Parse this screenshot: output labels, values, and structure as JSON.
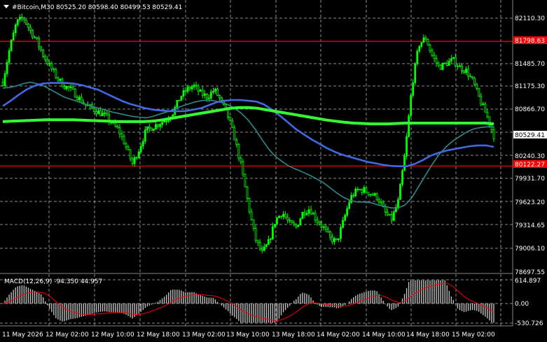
{
  "header": {
    "symbol_title": "#Bitcoin,M30",
    "ohlc": "80525.20 80598.40 80499.53 80529.41",
    "collapse_icon": "triangle-down-icon"
  },
  "colors": {
    "background": "#000000",
    "grid": "#ffffff",
    "bull_candle": "#00ff00",
    "ma_fast": "#2e8b8b",
    "ma_mid": "#4169e1",
    "ma_slow": "#33ff33",
    "hline": "#ff0000",
    "hline_label_bg": "#ff0000",
    "macd_hist": "#c0c0c0",
    "macd_signal": "#ff0000"
  },
  "price_axis": {
    "ticks": [
      "82110.30",
      "81485.70",
      "81175.30",
      "80866.70",
      "80240.30",
      "79931.70",
      "79623.20",
      "79314.65",
      "79006.10",
      "78697.55"
    ]
  },
  "price_tags": {
    "current": "80529.41",
    "level_top": "81798.63",
    "level_bottom": "80122.27"
  },
  "macd": {
    "label": "MACD(12,26,9) -94.350 44.957",
    "ticks": [
      "614.897",
      "0.00",
      "-530.726"
    ]
  },
  "time_axis": {
    "labels": [
      "11 May 2026",
      "12 May 02:00",
      "12 May 10:00",
      "12 May 18:00",
      "13 May 02:00",
      "13 May 10:00",
      "13 May 18:00",
      "14 May 02:00",
      "14 May 10:00",
      "14 May 18:00",
      "15 May 02:00"
    ]
  },
  "chart_data": {
    "type": "candlestick",
    "symbol": "#Bitcoin",
    "timeframe": "M30",
    "y_range": [
      78697.55,
      82110.3
    ],
    "horizontal_levels": [
      81798.63,
      80122.27
    ],
    "last_close": 80529.41,
    "series": [
      {
        "values": [
          81250,
          81700,
          82050,
          82120,
          81950,
          81800,
          81600,
          81450,
          81300,
          81200,
          81150,
          81050,
          80950,
          80900,
          80850,
          80800,
          80700,
          80600,
          80400,
          80150,
          80350,
          80600,
          80650,
          80700,
          80750,
          80850,
          81050,
          81150,
          81200,
          81100,
          81050,
          81150,
          81000,
          80800,
          80500,
          80100,
          79600,
          79150,
          78950,
          79100,
          79400,
          79500,
          79350,
          79300,
          79500,
          79550,
          79400,
          79300,
          79150,
          79100,
          79400,
          79700,
          79800,
          79800,
          79750,
          79700,
          79500,
          79400,
          79650,
          80300,
          81200,
          81750,
          81850,
          81600,
          81450,
          81500,
          81550,
          81450,
          81400,
          81250,
          81000,
          80800,
          80530
        ]
      },
      {
        "values": [
          81170,
          81180,
          81200,
          81230,
          81250,
          81230,
          81200,
          81150,
          81100,
          81050,
          81020,
          80990,
          80960,
          80930,
          80900,
          80880,
          80850,
          80830,
          80810,
          80790,
          80780,
          80770,
          80790,
          80820,
          80850,
          80880,
          80920,
          80950,
          80980,
          81000,
          81010,
          81000,
          80980,
          80950,
          80900,
          80830,
          80740,
          80620,
          80480,
          80350,
          80250,
          80180,
          80120,
          80080,
          80040,
          80000,
          79950,
          79900,
          79830,
          79760,
          79700,
          79660,
          79640,
          79640,
          79630,
          79600,
          79580,
          79560,
          79560,
          79600,
          79700,
          79850,
          80000,
          80150,
          80280,
          80380,
          80460,
          80520,
          80580,
          80620,
          80640,
          80650,
          80650
        ]
      },
      {
        "values": [
          80930,
          81000,
          81080,
          81150,
          81200,
          81230,
          81240,
          81240,
          81240,
          81230,
          81210,
          81180,
          81150,
          81100,
          81050,
          81000,
          80960,
          80930,
          80900,
          80880,
          80870,
          80860,
          80860,
          80860,
          80880,
          80900,
          80940,
          80980,
          81000,
          81010,
          81010,
          81000,
          80990,
          80950,
          80880,
          80800,
          80710,
          80620,
          80550,
          80480,
          80420,
          80360,
          80310,
          80270,
          80240,
          80210,
          80180,
          80160,
          80140,
          80125,
          80120,
          80120,
          80150,
          80200,
          80260,
          80300,
          80330,
          80350,
          80370,
          80390,
          80400,
          80400,
          80380
        ]
      },
      {
        "values": [
          80720,
          80725,
          80730,
          80735,
          80740,
          80745,
          80745,
          80745,
          80745,
          80740,
          80735,
          80730,
          80725,
          80720,
          80720,
          80720,
          80720,
          80725,
          80740,
          80760,
          80780,
          80800,
          80820,
          80840,
          80860,
          80880,
          80900,
          80910,
          80910,
          80900,
          80880,
          80860,
          80840,
          80820,
          80800,
          80780,
          80760,
          80740,
          80725,
          80710,
          80700,
          80695,
          80690,
          80690,
          80690,
          80695,
          80700,
          80700,
          80700,
          80700,
          80700,
          80700,
          80700,
          80700,
          80700,
          80700,
          80690
        ]
      }
    ],
    "macd": {
      "main": -94.35,
      "signal": 44.957,
      "range": [
        -530.726,
        614.897
      ]
    }
  }
}
